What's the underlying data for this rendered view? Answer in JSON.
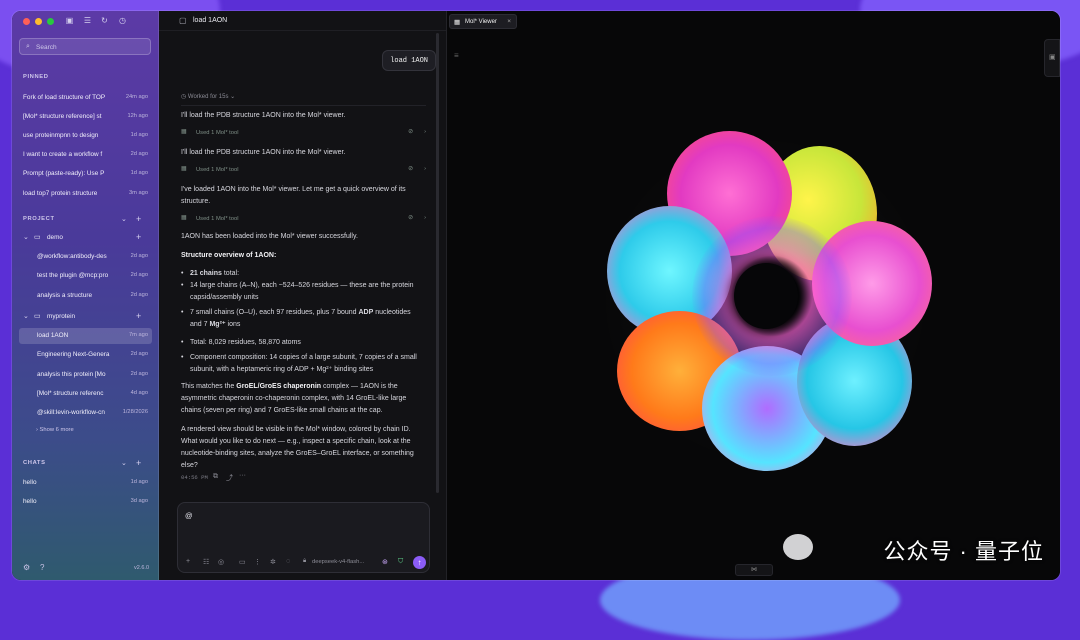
{
  "window_colors": {
    "close": "#ff5f57",
    "minimize": "#febc2e",
    "maximize": "#28c840"
  },
  "search": {
    "placeholder": "Search"
  },
  "pinned": {
    "heading": "PINNED",
    "items": [
      {
        "label": "Fork of load structure of TOP",
        "time": "24m ago"
      },
      {
        "label": "[Mol* structure reference] st",
        "time": "12h ago"
      },
      {
        "label": "use proteinmpnn to design",
        "time": "1d ago"
      },
      {
        "label": "I want to create a workflow f",
        "time": "2d ago"
      },
      {
        "label": "Prompt (paste-ready): Use P",
        "time": "1d ago"
      },
      {
        "label": "load top7 protein structure",
        "time": "3m ago"
      }
    ]
  },
  "project": {
    "heading": "PROJECT",
    "folders": [
      {
        "name": "demo",
        "items": [
          {
            "label": "@workflow:antibody-des",
            "time": "2d ago"
          },
          {
            "label": "test the plugin @mcp:pro",
            "time": "2d ago"
          },
          {
            "label": "analysis a structure",
            "time": "2d ago"
          }
        ]
      },
      {
        "name": "myprotein",
        "items": [
          {
            "label": "load 1AON",
            "time": "7m ago"
          },
          {
            "label": "Engineering Next-Genera",
            "time": "2d ago"
          },
          {
            "label": "analysis this protein [Mo",
            "time": "2d ago"
          },
          {
            "label": "[Mol* structure referenc",
            "time": "4d ago"
          },
          {
            "label": "@skill:levin-workflow-cn",
            "time": "1/28/2026"
          }
        ]
      }
    ],
    "show_more": "Show 6 more"
  },
  "chats": {
    "heading": "CHATS",
    "items": [
      {
        "label": "hello",
        "time": "1d ago"
      },
      {
        "label": "hello",
        "time": "3d ago"
      }
    ]
  },
  "footer": {
    "version": "v2.6.0"
  },
  "chat": {
    "title": "load 1AON",
    "user_message": "load 1AON",
    "worked_for": "Worked for 15s",
    "tool_label": "Used 1 Mol* tool",
    "msg1": "I'll load the PDB structure 1AON into the Mol* viewer.",
    "msg2": "I'll load the PDB structure 1AON into the Mol* viewer.",
    "msg3": "I've loaded 1AON into the Mol* viewer. Let me get a quick overview of its structure.",
    "msg4": "1AON has been loaded into the Mol* viewer successfully.",
    "overview_heading": "Structure overview of 1AON:",
    "bullets": {
      "b1_bold": "21 chains",
      "b1_rest": " total:",
      "b2": "14 large chains (A–N), each ~524–526 residues — these are the protein capsid/assembly units",
      "b3_pre": "7 small chains (O–U), each 97 residues, plus 7 bound ",
      "b3_bold1": "ADP",
      "b3_mid": " nucleotides and 7 ",
      "b3_bold2": "Mg²⁺",
      "b3_post": " ions",
      "b4": "Total: 8,029 residues, 58,870 atoms",
      "b5": "Component composition: 14 copies of a large subunit, 7 copies of a small subunit, with a heptameric ring of ADP + Mg²⁺ binding sites"
    },
    "match_pre": "This matches the ",
    "match_bold": "GroEL/GroES chaperonin",
    "match_post": " complex — 1AON is the asymmetric chaperonin co-chaperonin complex, with 14 GroEL-like large chains (seven per ring) and 7 GroES-like small chains at the cap.",
    "closing": "A rendered view should be visible in the Mol* window, colored by chain ID. What would you like to do next — e.g., inspect a specific chain, look at the nucleotide-binding sites, analyze the GroES–GroEL interface, or something else?",
    "timestamp": "04:56 PM",
    "composer_value": "@",
    "model": "deepseek-v4-flash..."
  },
  "viewer": {
    "tab_label": "Mol* Viewer"
  },
  "watermark": "公众号 · 量子位",
  "accent_color": "#8b5cf6"
}
